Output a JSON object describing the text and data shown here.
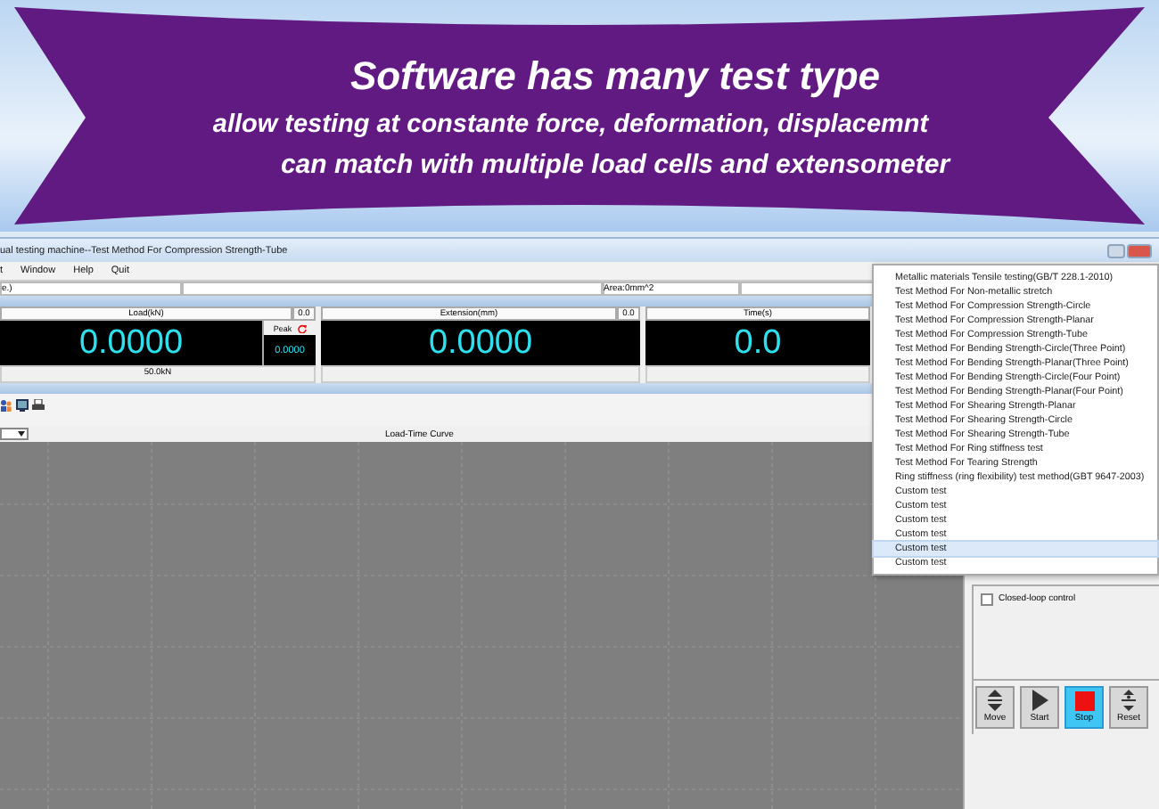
{
  "banner": {
    "lines": [
      "Software has many test type",
      "allow testing at constante force, deformation, displacemnt",
      "can match with multiple load cells and extensometer"
    ]
  },
  "window": {
    "title": "ual testing machine--Test Method For Compression Strength-Tube"
  },
  "menu": [
    "t",
    "Window",
    "Help",
    "Quit"
  ],
  "info": {
    "field": "e.)",
    "area": "Area:0mm^2"
  },
  "meters": [
    {
      "label": "Load(kN)",
      "value": "0.0000",
      "unit_box": "0.0",
      "peak_label": "Peak",
      "peak_value": "0.0000",
      "footer": "50.0kN"
    },
    {
      "label": "Extension(mm)",
      "value": "0.0000",
      "unit_box": "0.0"
    },
    {
      "label": "Time(s)",
      "value": "0.0"
    }
  ],
  "chart_select": {
    "title": "Load-Time Curve"
  },
  "closed_loop": {
    "label": "Closed-loop control",
    "checked": false
  },
  "controls": [
    {
      "kind": "move",
      "label": "Move",
      "selected": false
    },
    {
      "kind": "start",
      "label": "Start",
      "selected": false
    },
    {
      "kind": "stop",
      "label": "Stop",
      "selected": true
    },
    {
      "kind": "reset",
      "label": "Reset",
      "selected": false
    }
  ],
  "test_menu": [
    {
      "label": "Metallic materials Tensile testing(GB/T 228.1-2010)",
      "selected": false
    },
    {
      "label": "Test Method For Non-metallic stretch",
      "selected": false
    },
    {
      "label": "Test Method For Compression Strength-Circle",
      "selected": false
    },
    {
      "label": "Test Method For Compression Strength-Planar",
      "selected": false
    },
    {
      "label": "Test Method For Compression Strength-Tube",
      "selected": false
    },
    {
      "label": "Test Method For Bending Strength-Circle(Three Point)",
      "selected": false
    },
    {
      "label": "Test Method For Bending Strength-Planar(Three Point)",
      "selected": false
    },
    {
      "label": "Test Method For Bending Strength-Circle(Four Point)",
      "selected": false
    },
    {
      "label": "Test Method For Bending Strength-Planar(Four Point)",
      "selected": false
    },
    {
      "label": "Test Method For Shearing Strength-Planar",
      "selected": false
    },
    {
      "label": "Test Method For Shearing Strength-Circle",
      "selected": false
    },
    {
      "label": "Test Method For Shearing Strength-Tube",
      "selected": false
    },
    {
      "label": "Test Method For Ring stiffness test",
      "selected": false
    },
    {
      "label": "Test Method For Tearing Strength",
      "selected": false
    },
    {
      "label": "Ring stiffness (ring flexibility) test method(GBT 9647-2003)",
      "selected": false
    },
    {
      "label": "Custom test",
      "selected": false
    },
    {
      "label": "Custom test",
      "selected": false
    },
    {
      "label": "Custom test",
      "selected": false
    },
    {
      "label": "Custom test",
      "selected": false
    },
    {
      "label": "Custom test",
      "selected": true
    },
    {
      "label": "Custom test",
      "selected": false
    }
  ]
}
